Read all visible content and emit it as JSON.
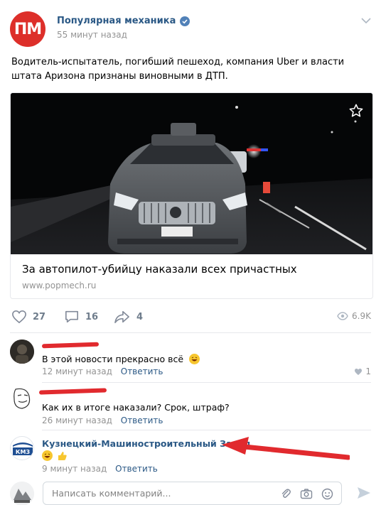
{
  "post": {
    "author": "Популярная механика",
    "avatar_text": "ПМ",
    "time": "55 минут назад",
    "text": "Водитель-испытатель, погибший пешеход, компания Uber и власти штата Аризона признаны виновными в ДТП.",
    "link_title": "За автопилот-убийцу наказали всех причастных",
    "link_domain": "www.popmech.ru",
    "likes": "27",
    "comments": "16",
    "shares": "4",
    "views": "6.9K"
  },
  "comments": [
    {
      "text": "В этой новости прекрасно всё",
      "time": "12 минут назад",
      "reply": "Ответить",
      "likes": "1",
      "emoji": "laughing"
    },
    {
      "text": "Как их в итоге наказали? Срок, штраф?",
      "time": "26 минут назад",
      "reply": "Ответить"
    },
    {
      "name": "Кузнецкий-Машиностроительный Завод",
      "avatar_text": "КМЗ",
      "time": "9 минут назад",
      "reply": "Ответить",
      "emoji": "laughing + thumbs-up"
    }
  ],
  "comment_input": {
    "placeholder": "Написать комментарий..."
  },
  "colors": {
    "brand_red": "#dd2f2a",
    "link_blue": "#2a5885",
    "muted": "#939393",
    "annotation_red": "#e12a2e"
  },
  "icons": [
    "verified-icon",
    "chevron-down-icon",
    "star-icon",
    "heart-icon",
    "comment-icon",
    "share-icon",
    "eye-icon",
    "attach-icon",
    "camera-icon",
    "smile-icon",
    "send-icon"
  ]
}
